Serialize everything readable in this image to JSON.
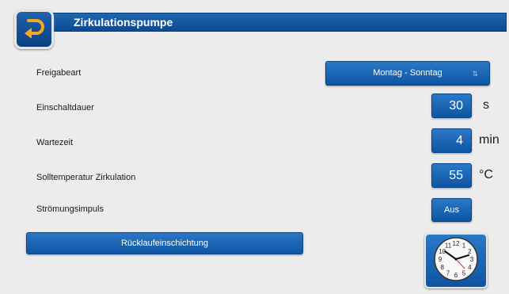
{
  "header": {
    "title": "Zirkulationspumpe"
  },
  "icons": {
    "back": "return-arrow-icon",
    "clock": "clock-icon"
  },
  "colors": {
    "accent": "#0e55a3",
    "back_arrow": "#f5a623"
  },
  "settings": {
    "freigabeart": {
      "label": "Freigabeart",
      "value": "Montag - Sonntag",
      "dropdown_marker": "⇅"
    },
    "einschaltdauer": {
      "label": "Einschaltdauer",
      "value": "30",
      "unit": "s"
    },
    "wartezeit": {
      "label": "Wartezeit",
      "value": "4",
      "unit": "min"
    },
    "solltemperatur": {
      "label": "Solltemperatur Zirkulation",
      "value": "55",
      "unit": "°C"
    },
    "stroemungsimpuls": {
      "label": "Strömungsimpuls",
      "value": "Aus"
    }
  },
  "actions": {
    "ruecklauf_label": "Rücklaufeinschichtung"
  },
  "clock": {
    "numerals": [
      "12",
      "1",
      "2",
      "3",
      "4",
      "5",
      "6",
      "7",
      "8",
      "9",
      "10",
      "11"
    ]
  }
}
